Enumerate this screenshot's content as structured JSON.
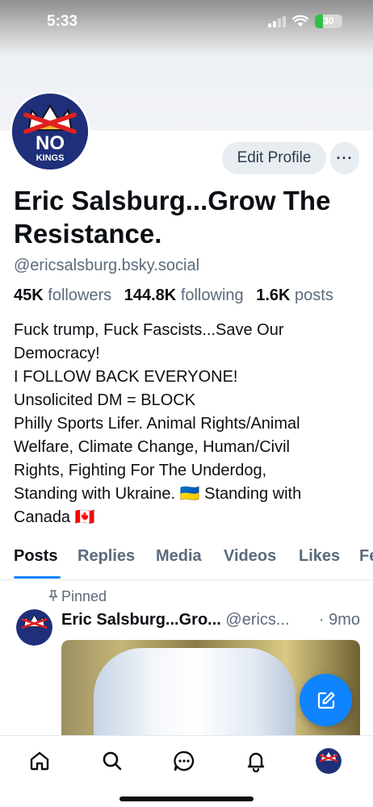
{
  "status_bar": {
    "time": "5:33",
    "battery": "30",
    "battery_level": 0.3,
    "icons": [
      "signal-icon",
      "wifi-icon",
      "battery-icon"
    ]
  },
  "profile": {
    "avatar_text": "NO",
    "avatar_subtext": "KINGS",
    "edit_profile_label": "Edit Profile",
    "more_label": "···",
    "display_name": "Eric Salsburg...Grow The Resistance.",
    "handle": "@ericsalsburg.bsky.social",
    "stats": {
      "followers_count": "45K",
      "followers_label": "followers",
      "following_count": "144.8K",
      "following_label": "following",
      "posts_count": "1.6K",
      "posts_label": "posts"
    },
    "bio_lines": [
      "Fuck trump, Fuck Fascists...Save Our",
      "Democracy!",
      "I FOLLOW BACK EVERYONE!",
      "Unsolicited DM = BLOCK",
      "Philly Sports Lifer. Animal Rights/Animal",
      "Welfare, Climate Change, Human/Civil",
      "Rights, Fighting For The Underdog,",
      "Standing with Ukraine.  🇺🇦 Standing with",
      "Canada 🇨🇦"
    ]
  },
  "tabs": [
    {
      "label": "Posts",
      "active": true
    },
    {
      "label": "Replies",
      "active": false
    },
    {
      "label": "Media",
      "active": false
    },
    {
      "label": "Videos",
      "active": false
    },
    {
      "label": "Likes",
      "active": false
    },
    {
      "label": "Fe",
      "active": false
    }
  ],
  "post": {
    "pinned_label": "Pinned",
    "author": "Eric Salsburg...Gro...",
    "handle": "@erics...",
    "time": "· 9mo"
  },
  "fab": {
    "icon": "compose-icon"
  },
  "bottom_nav": {
    "items": [
      "home-icon",
      "search-icon",
      "chat-icon",
      "bell-icon",
      "profile-avatar"
    ]
  },
  "colors": {
    "accent": "#1083fe",
    "text_primary": "#0b0f14",
    "text_secondary": "#5b6a7b",
    "button_bg": "#e8edf2"
  }
}
